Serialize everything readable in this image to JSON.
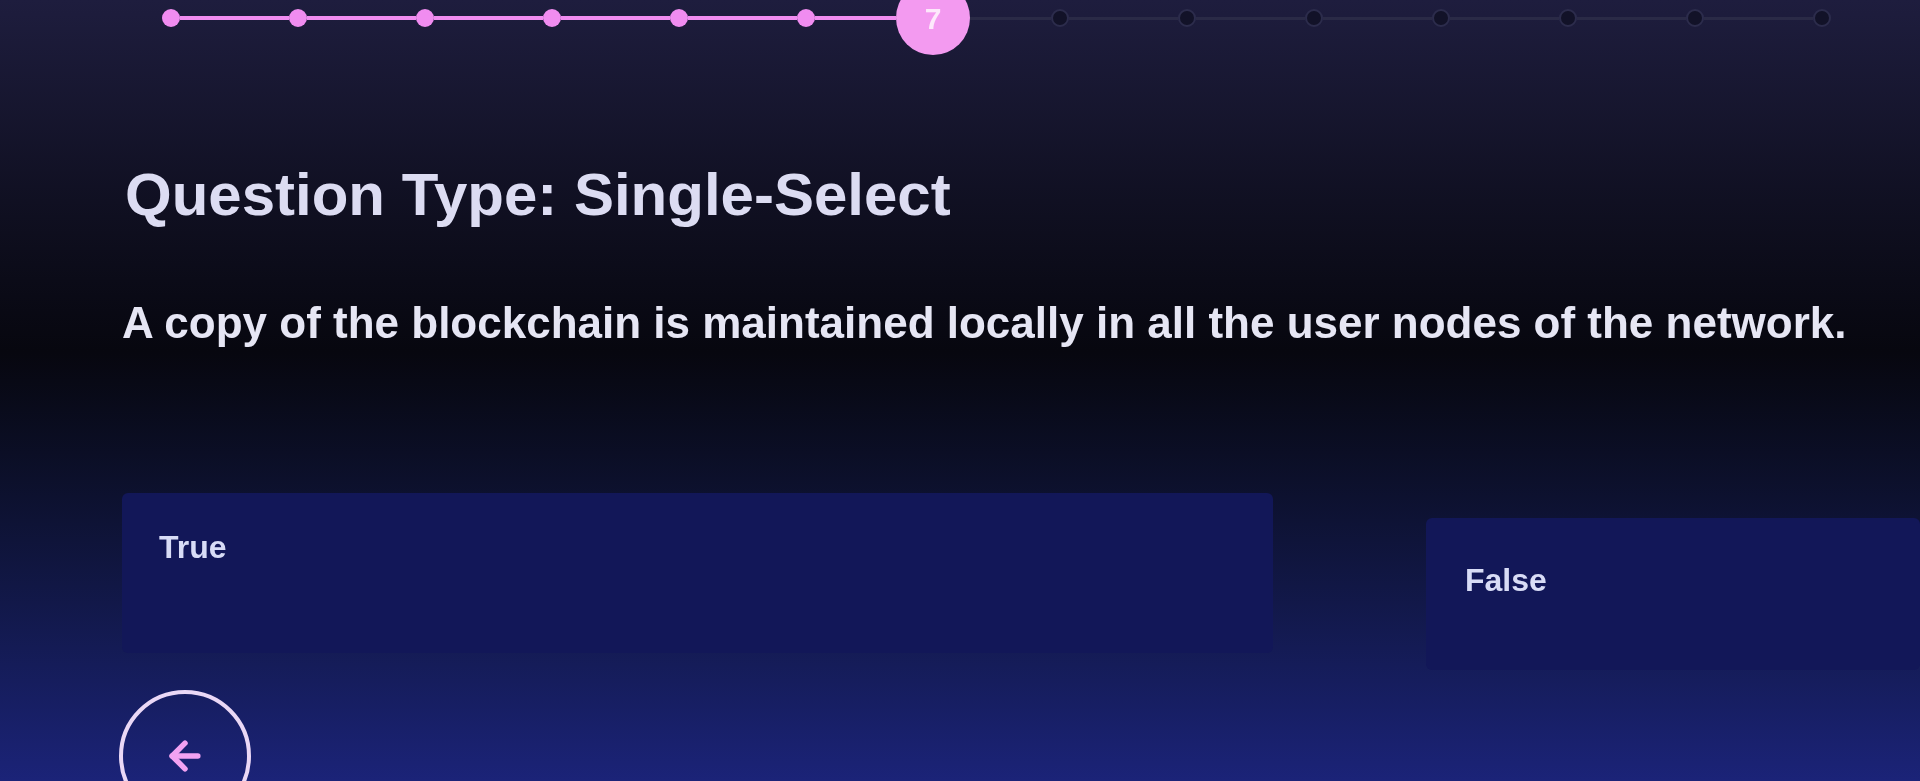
{
  "progress": {
    "steps": [
      {
        "completed": true,
        "selected": false
      },
      {
        "completed": true,
        "selected": false
      },
      {
        "completed": true,
        "selected": false
      },
      {
        "completed": true,
        "selected": false
      },
      {
        "completed": true,
        "selected": false
      },
      {
        "completed": true,
        "selected": false
      },
      {
        "label": "7",
        "completed": false,
        "selected": true
      },
      {
        "completed": false,
        "selected": false
      },
      {
        "completed": false,
        "selected": false
      },
      {
        "completed": false,
        "selected": false
      },
      {
        "completed": false,
        "selected": false
      },
      {
        "completed": false,
        "selected": false
      },
      {
        "completed": false,
        "selected": false
      },
      {
        "completed": false,
        "selected": false
      }
    ]
  },
  "question": {
    "type_heading": "Question Type: Single-Select",
    "text": "A copy of the blockchain is maintained locally in all the user nodes of the network."
  },
  "options": [
    {
      "label": "True",
      "selected": false
    },
    {
      "label": "False",
      "selected": false
    }
  ]
}
